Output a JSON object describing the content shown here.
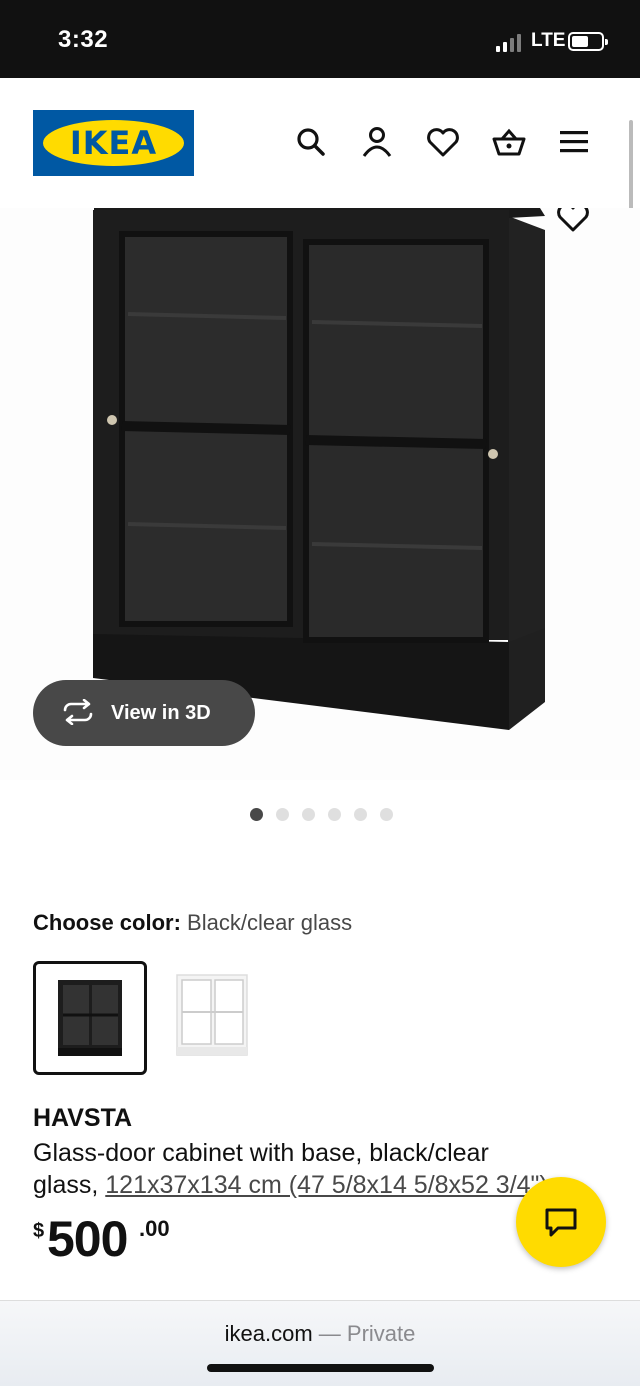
{
  "status_bar": {
    "time": "3:32",
    "network": "LTE"
  },
  "header": {
    "logo_text": "IKEA",
    "icons": [
      "search-icon",
      "account-icon",
      "favorites-icon",
      "cart-icon",
      "menu-icon"
    ]
  },
  "hero": {
    "view_3d_label": "View in 3D",
    "slide_count": 6,
    "active_slide": 1
  },
  "color_picker": {
    "label": "Choose color:",
    "value": "Black/clear glass",
    "swatches": [
      "Black/clear glass",
      "White/clear glass"
    ]
  },
  "product": {
    "name": "HAVSTA",
    "desc_prefix": "Glass-door cabinet with base, black/clear",
    "desc_line2": "glass,",
    "dimensions": "121x37x134 cm (47 5/8x14 5/8x52 3/4\")",
    "currency": "$",
    "price_int": "500",
    "price_dec": ".00"
  },
  "safari": {
    "domain": "ikea.com",
    "mode": "— Private"
  },
  "colors": {
    "ikea_blue": "#0058a3",
    "ikea_yellow": "#ffdb00",
    "dark_pill": "#484848"
  }
}
